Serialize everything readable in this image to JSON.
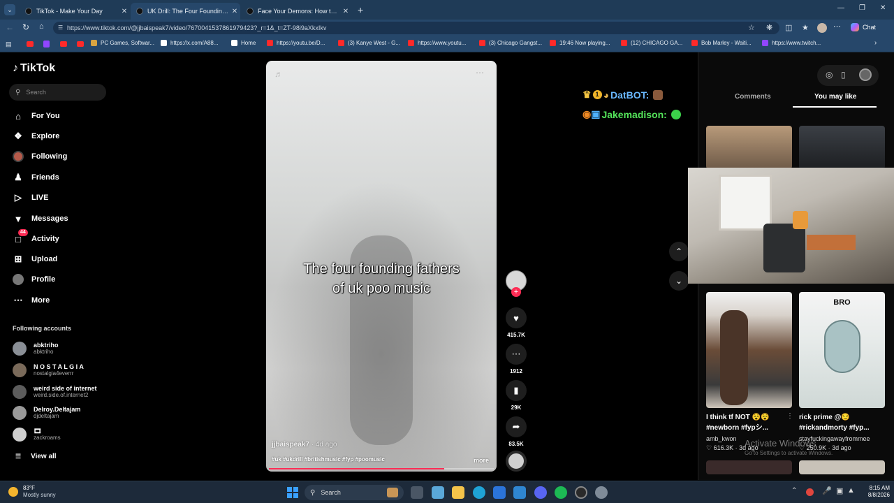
{
  "browser": {
    "tabs": [
      {
        "title": "TikTok - Make Your Day"
      },
      {
        "title": "UK Drill: The Four Founding Fathe"
      },
      {
        "title": "Face Your Demons: How to Stop S"
      }
    ],
    "url": "https://www.tiktok.com/@jjbaispeak7/video/7670041537861979423?_r=1&_t=ZT-98i9aXkxIkv",
    "chat_label": "Chat",
    "bookmarks": [
      {
        "label": "PC Games, Softwar...",
        "color": "#d9a441"
      },
      {
        "label": "https://x.com/A88...",
        "color": "#ffffff"
      },
      {
        "label": "Home",
        "color": "#ffffff"
      },
      {
        "label": "https://youtu.be/D...",
        "color": "#ff2a2a"
      },
      {
        "label": "(3) Kanye West - G...",
        "color": "#ff2a2a"
      },
      {
        "label": "https://www.youtu...",
        "color": "#ff2a2a"
      },
      {
        "label": "(3) Chicago Gangst...",
        "color": "#ff2a2a"
      },
      {
        "label": "19:46 Now playing...",
        "color": "#ff2a2a"
      },
      {
        "label": "(12) CHICAGO GA...",
        "color": "#ff2a2a"
      },
      {
        "label": "Bob Marley - Waiti...",
        "color": "#ff2a2a"
      },
      {
        "label": "https://www.twitch...",
        "color": "#9146ff"
      }
    ]
  },
  "sidebar": {
    "logo": "TikTok",
    "search_placeholder": "Search",
    "nav": [
      {
        "label": "For You",
        "icon": "home-icon"
      },
      {
        "label": "Explore",
        "icon": "compass-icon"
      },
      {
        "label": "Following",
        "icon": "avatar-icon"
      },
      {
        "label": "Friends",
        "icon": "friends-icon"
      },
      {
        "label": "LIVE",
        "icon": "live-icon"
      },
      {
        "label": "Messages",
        "icon": "messages-icon"
      },
      {
        "label": "Activity",
        "icon": "activity-icon",
        "badge": "44"
      },
      {
        "label": "Upload",
        "icon": "upload-icon"
      },
      {
        "label": "Profile",
        "icon": "profile-icon"
      },
      {
        "label": "More",
        "icon": "more-icon"
      }
    ],
    "following_heading": "Following accounts",
    "accounts": [
      {
        "name": "abktriho",
        "handle": "abktriho"
      },
      {
        "name": "N O S T A L G I A",
        "handle": "nostalgia4everrr"
      },
      {
        "name": "weird side of internet",
        "handle": "weird.side.of.internet2"
      },
      {
        "name": "Delroy.Deltajam",
        "handle": "djdeltajam"
      },
      {
        "name": "🎞",
        "handle": "zackroams"
      }
    ],
    "view_all": "View all"
  },
  "video": {
    "caption_line1": "The four founding fathers",
    "caption_line2": "of uk poo music",
    "author": "jjbaispeak7",
    "age": "4d ago",
    "hashtags": "#uk #ukdrill #britishmusic #fyp #poomusic",
    "more": "more"
  },
  "actions": {
    "likes": "415.7K",
    "comments": "1912",
    "saves": "29K",
    "shares": "83.5K"
  },
  "live_chat": {
    "line1_user": "DatBOT:",
    "line2_user": "Jakemadison:"
  },
  "right_panel": {
    "tab_comments": "Comments",
    "tab_like": "You may like",
    "cards": [
      {
        "title1": "I think tf NOT 😵😵",
        "title2": "#newborn #fypシ...",
        "author": "amb_kwon",
        "likes": "616.3K",
        "age": "3d ago",
        "overlay": ""
      },
      {
        "title1": "rick prime @😏",
        "title2": "#rickandmorty #fyp...",
        "author": "stayfuckingawayfrommee",
        "likes": "250.9K",
        "age": "3d ago",
        "overlay": "BRO"
      }
    ],
    "activate_title": "Activate Windows",
    "activate_sub": "Go to Settings to activate Windows."
  },
  "taskbar": {
    "temp": "83°F",
    "weather": "Mostly sunny",
    "search": "Search",
    "time": "8:15 AM",
    "date": "8/8/2026"
  }
}
